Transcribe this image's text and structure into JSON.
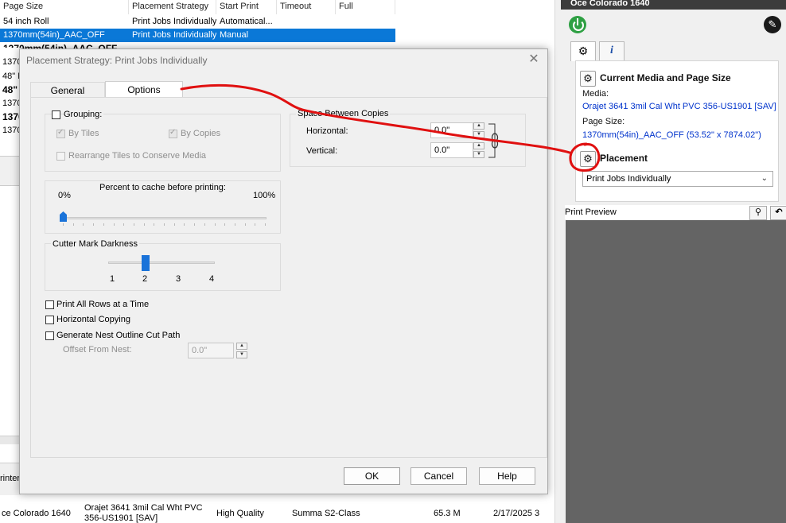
{
  "job_table": {
    "columns": [
      "Page Size",
      "Placement Strategy",
      "Start Print",
      "Timeout",
      "Full"
    ],
    "rows": [
      {
        "page_size": "54 inch Roll",
        "strategy": "Print Jobs Individually",
        "start_print": "Automatical..."
      },
      {
        "page_size": "1370mm(54in)_AAC_OFF",
        "strategy": "Print Jobs Individually",
        "start_print": "Manual"
      },
      {
        "page_size": "1370mm(54in)_AAC_OFF",
        "strategy": "",
        "start_print": ""
      }
    ],
    "left_fragments": [
      "1370",
      "48\" F",
      "48\"",
      "1370",
      "1370",
      "1370"
    ],
    "lower_fragment": "rinter",
    "bottom_row": {
      "printer": "ce Colorado 1640",
      "media_line1": "Orajet 3641 3mil Cal Wht PVC",
      "media_line2": "356-US1901 [SAV]",
      "quality": "High Quality",
      "cutter": "Summa S2-Class",
      "size": "65.3 M",
      "date": "2/17/2025 3"
    }
  },
  "printer_panel": {
    "title": "Oce Colorado 1640",
    "current_media_header": "Current Media and Page Size",
    "media_label": "Media:",
    "media_value": "Orajet 3641 3mil Cal Wht PVC 356-US1901 [SAV]",
    "page_size_label": "Page Size:",
    "page_size_value": "1370mm(54in)_AAC_OFF (53.52\" x 7874.02\")",
    "placement_header": "Placement",
    "placement_value": "Print Jobs Individually",
    "preview_label": "Print Preview"
  },
  "dialog": {
    "title": "Placement Strategy: Print Jobs Individually",
    "tabs": {
      "general": "General",
      "options": "Options"
    },
    "grouping": {
      "label": "Grouping:",
      "by_tiles": "By Tiles",
      "by_copies": "By Copies",
      "rearrange": "Rearrange Tiles to Conserve Media"
    },
    "cache": {
      "label": "Percent to cache before printing:",
      "min": "0%",
      "max": "100%",
      "value_percent": 0
    },
    "cutter": {
      "label": "Cutter Mark Darkness",
      "ticks": [
        "1",
        "2",
        "3",
        "4"
      ],
      "value": 2
    },
    "space": {
      "label": "Space Between Copies",
      "horizontal_label": "Horizontal:",
      "horizontal_value": "0.0\"",
      "vertical_label": "Vertical:",
      "vertical_value": "0.0\""
    },
    "print_all_rows": "Print All Rows at a Time",
    "horizontal_copying": "Horizontal Copying",
    "nest_outline": "Generate Nest Outline Cut Path",
    "offset_label": "Offset From Nest:",
    "offset_value": "0.0\"",
    "buttons": {
      "ok": "OK",
      "cancel": "Cancel",
      "help": "Help"
    }
  },
  "colors": {
    "selection": "#0a78d7",
    "link_blue": "#0033cc",
    "annotation_red": "#e01010",
    "preview_bg": "#646464",
    "slider_thumb": "#1a73d9"
  }
}
